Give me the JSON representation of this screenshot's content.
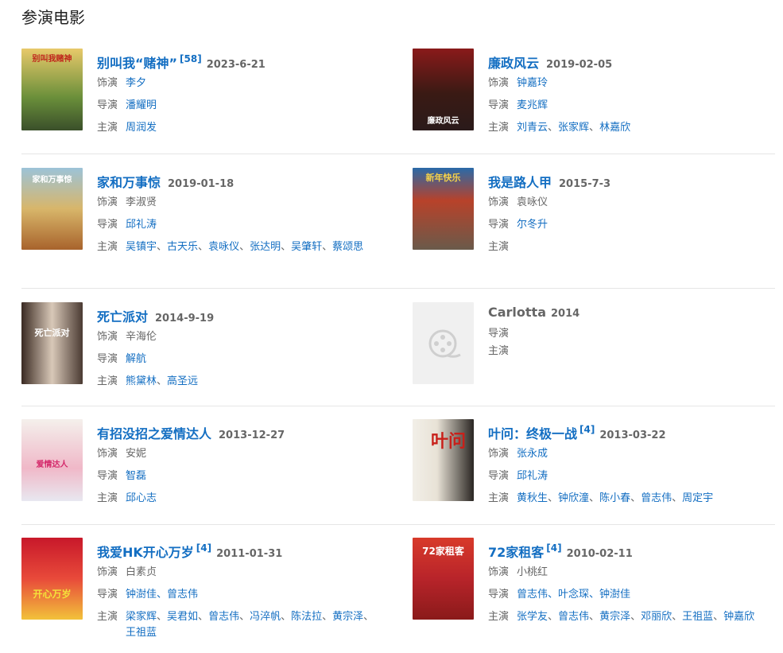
{
  "section": {
    "title": "参演电影"
  },
  "labels": {
    "role": "饰演",
    "director": "导演",
    "cast": "主演"
  },
  "movies": [
    {
      "title": "别叫我“赌神”",
      "badge": "[58]",
      "date": "2023-6-21",
      "role": "李夕",
      "director": "潘耀明",
      "cast": [
        "周润发"
      ],
      "poster_text": "别叫我赌神"
    },
    {
      "title": "廉政风云",
      "badge": "",
      "date": "2019-02-05",
      "role": "钟嘉玲",
      "director": "麦兆辉",
      "cast": [
        "刘青云",
        "张家辉",
        "林嘉欣"
      ],
      "poster_text": "廉政风云"
    },
    {
      "title": "家和万事惊",
      "badge": "",
      "date": "2019-01-18",
      "role": "李淑贤",
      "director": "邱礼涛",
      "cast": [
        "吴镇宇",
        "古天乐",
        "袁咏仪",
        "张达明",
        "吴肇轩",
        "蔡颂思"
      ],
      "poster_text": "家和万事惊"
    },
    {
      "title": "我是路人甲",
      "badge": "",
      "date": "2015-7-3",
      "role": "袁咏仪",
      "director": "尔冬升",
      "cast": [],
      "poster_text": "新年快乐"
    },
    {
      "title": "死亡派对",
      "badge": "",
      "date": "2014-9-19",
      "role": "辛海伦",
      "director": "解航",
      "cast": [
        "熊黛林",
        "高圣远"
      ],
      "poster_text": "死亡派对"
    },
    {
      "title": "Carlotta",
      "badge": "",
      "date": "2014",
      "role": null,
      "director": "",
      "cast": [],
      "poster_text": ""
    },
    {
      "title": "有招没招之爱情达人",
      "badge": "",
      "date": "2013-12-27",
      "role": "安妮",
      "director": "智磊",
      "cast": [
        "邱心志"
      ],
      "poster_text": "爱情达人"
    },
    {
      "title": "叶问：终极一战",
      "badge": "[4]",
      "date": "2013-03-22",
      "role": "张永成",
      "director": "邱礼涛",
      "cast": [
        "黄秋生",
        "钟欣潼",
        "陈小春",
        "曾志伟",
        "周定宇"
      ],
      "poster_text": "叶问"
    },
    {
      "title": "我爱HK开心万岁",
      "badge": "[4]",
      "date": "2011-01-31",
      "role": "白素贞",
      "director": "钟澍佳、曾志伟",
      "cast": [
        "梁家辉",
        "吴君如",
        "曾志伟",
        "冯淬帆",
        "陈法拉",
        "黄宗泽",
        "王祖蓝"
      ],
      "poster_text": "开心万岁"
    },
    {
      "title": "72家租客",
      "badge": "[4]",
      "date": "2010-02-11",
      "role": "小桃红",
      "director": "曾志伟、叶念琛、钟澍佳",
      "cast": [
        "张学友",
        "曾志伟",
        "黄宗泽",
        "邓丽欣",
        "王祖蓝",
        "钟嘉欣"
      ],
      "poster_text": "72家租客"
    }
  ],
  "colors": {
    "link": "#136ec2",
    "muted": "#666666",
    "divider": "#e6e6e6"
  }
}
